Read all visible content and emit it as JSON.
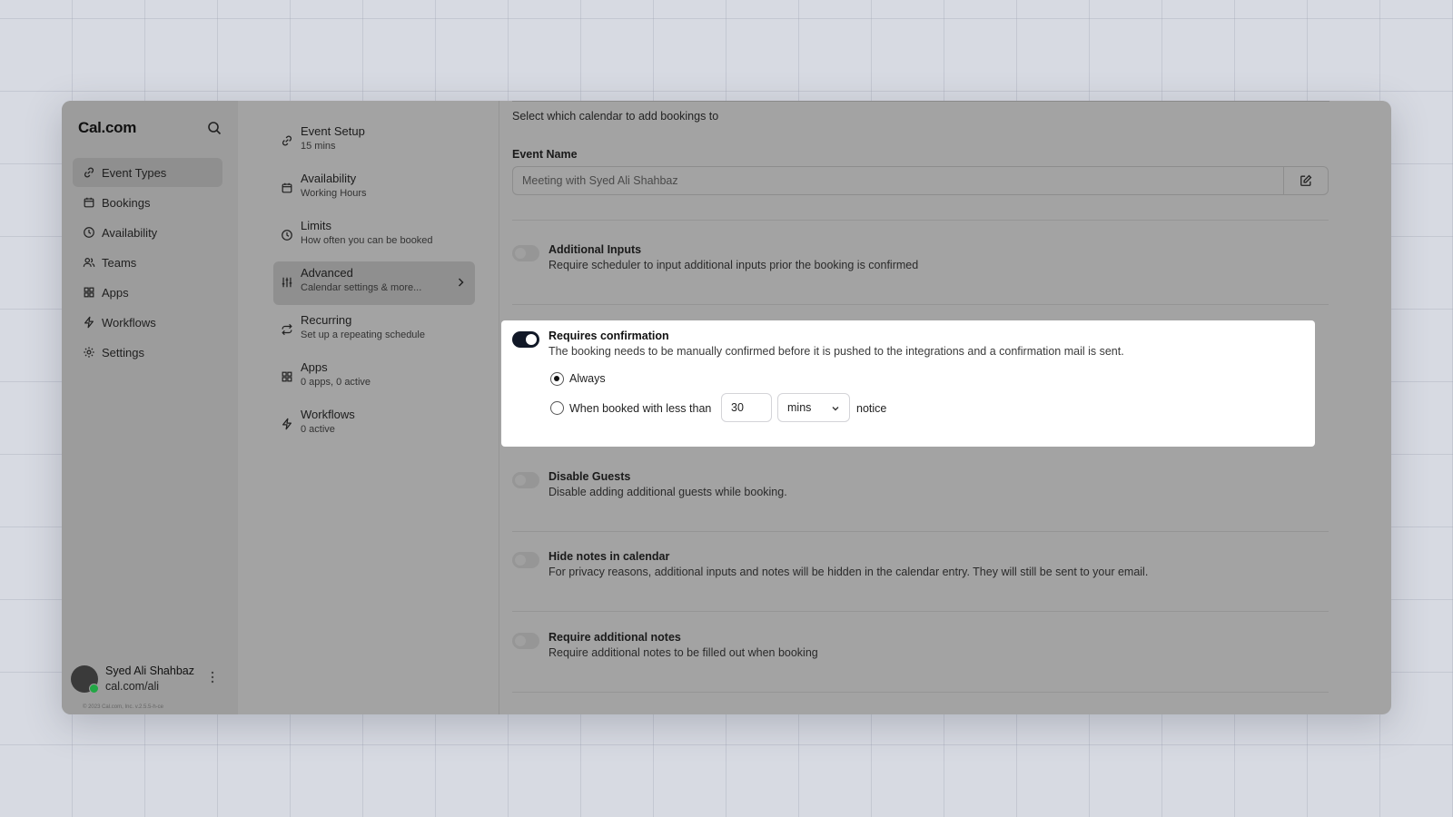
{
  "brand": "Cal.com",
  "sidebar": {
    "items": [
      {
        "label": "Event Types",
        "icon": "link-icon"
      },
      {
        "label": "Bookings",
        "icon": "calendar-icon"
      },
      {
        "label": "Availability",
        "icon": "clock-icon"
      },
      {
        "label": "Teams",
        "icon": "users-icon"
      },
      {
        "label": "Apps",
        "icon": "grid-icon"
      },
      {
        "label": "Workflows",
        "icon": "zap-icon"
      },
      {
        "label": "Settings",
        "icon": "gear-icon"
      }
    ],
    "user": {
      "name": "Syed Ali Shahbaz",
      "url": "cal.com/ali"
    },
    "copyright": "© 2023 Cal.com, Inc. v.2.5.5-h-ce"
  },
  "subnav": {
    "items": [
      {
        "title": "Event Setup",
        "desc": "15 mins"
      },
      {
        "title": "Availability",
        "desc": "Working Hours"
      },
      {
        "title": "Limits",
        "desc": "How often you can be booked"
      },
      {
        "title": "Advanced",
        "desc": "Calendar settings & more..."
      },
      {
        "title": "Recurring",
        "desc": "Set up a repeating schedule"
      },
      {
        "title": "Apps",
        "desc": "0 apps, 0 active"
      },
      {
        "title": "Workflows",
        "desc": "0 active"
      }
    ]
  },
  "main": {
    "calendar_desc": "Select which calendar to add bookings to",
    "event_name_label": "Event Name",
    "event_name_placeholder": "Meeting with Syed Ali Shahbaz",
    "settings": {
      "additional_inputs": {
        "title": "Additional Inputs",
        "desc": "Require scheduler to input additional inputs prior the booking is confirmed"
      },
      "requires_confirmation": {
        "title": "Requires confirmation",
        "desc": "The booking needs to be manually confirmed before it is pushed to the integrations and a confirmation mail is sent.",
        "option_always": "Always",
        "option_less_than": "When booked with less than",
        "notice_value": "30",
        "notice_unit": "mins",
        "notice_suffix": "notice"
      },
      "disable_guests": {
        "title": "Disable Guests",
        "desc": "Disable adding additional guests while booking."
      },
      "hide_notes": {
        "title": "Hide notes in calendar",
        "desc": "For privacy reasons, additional inputs and notes will be hidden in the calendar entry. They will still be sent to your email."
      },
      "require_notes": {
        "title": "Require additional notes",
        "desc": "Require additional notes to be filled out when booking"
      }
    }
  },
  "colors": {
    "toggle_on": "#111827",
    "online": "#22a745"
  }
}
